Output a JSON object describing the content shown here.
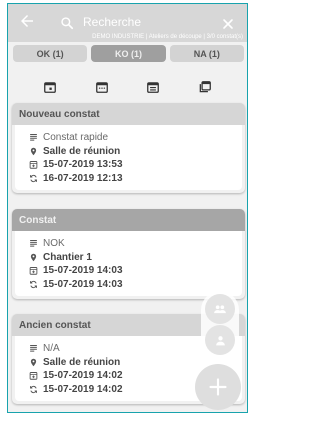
{
  "header": {
    "search_placeholder": "Recherche",
    "subtitle": "DEMO INDUSTRIE | Ateliers de découpe | 3/0 constat(s)",
    "icons": [
      "back-arrow-icon",
      "search-icon",
      "close-icon"
    ]
  },
  "filters": [
    {
      "label": "OK (1)",
      "active": false
    },
    {
      "label": "KO (1)",
      "active": true
    },
    {
      "label": "NA (1)",
      "active": false
    }
  ],
  "sort_icons": [
    "calendar-plus-icon",
    "calendar-icon",
    "calendar-list-icon",
    "copy-icon"
  ],
  "groups": [
    {
      "title": "Nouveau constat",
      "description": "Constat rapide",
      "location": "Salle de réunion",
      "created": "15-07-2019 13:53",
      "updated": "16-07-2019 12:13"
    },
    {
      "title": "Constat",
      "description": "NOK",
      "location": "Chantier 1",
      "created": "15-07-2019 14:03",
      "updated": "15-07-2019 14:03"
    },
    {
      "title": "Ancien constat",
      "description": "N/A",
      "location": "Salle de réunion",
      "created": "15-07-2019 14:02",
      "updated": "15-07-2019 14:02"
    }
  ],
  "fab": {
    "icons": [
      "group-icon",
      "person-icon",
      "add-icon"
    ]
  },
  "colors": {
    "frame_border": "#18a3ad",
    "header_bg": "#d7d7d7",
    "active_filter": "#9f9f9f"
  }
}
